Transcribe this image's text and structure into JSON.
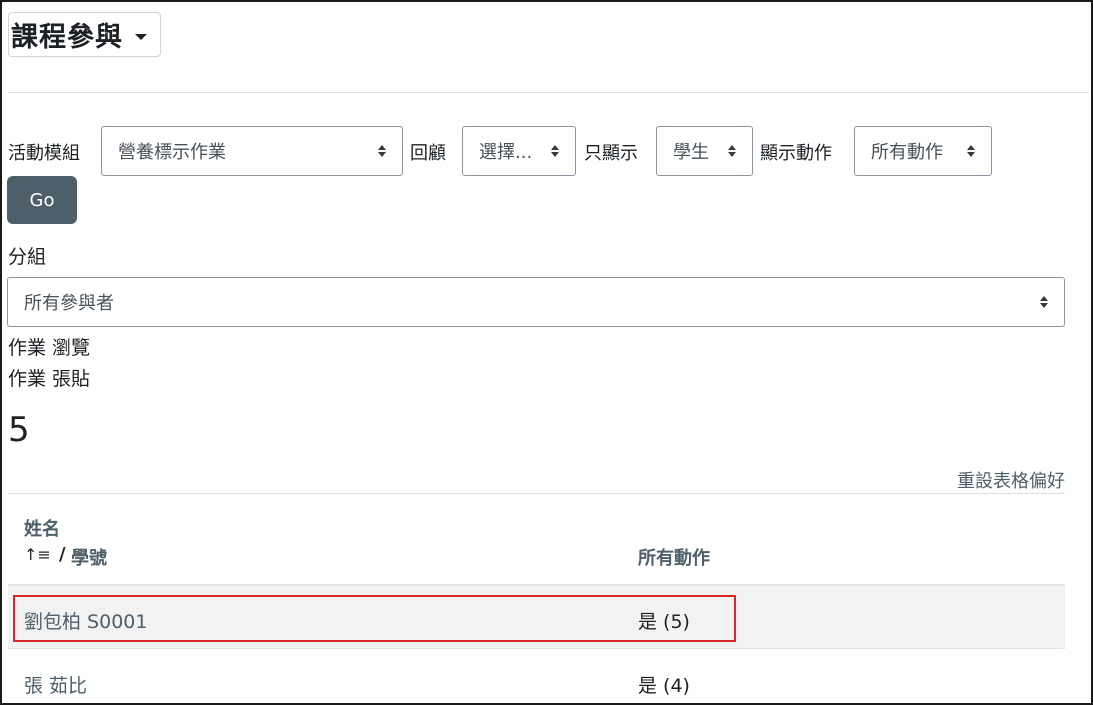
{
  "page_title": "課程參與",
  "filters": {
    "activity_label": "活動模組",
    "activity_value": "營養標示作業",
    "lookback_label": "回顧",
    "lookback_value": "選擇...",
    "show_only_label": "只顯示",
    "show_only_value": "學生",
    "show_actions_label": "顯示動作",
    "show_actions_value": "所有動作",
    "go_label": "Go",
    "group_label": "分組",
    "group_value": "所有參與者"
  },
  "info": {
    "line1": "作業 瀏覽",
    "line2": "作業 張貼",
    "count": "5"
  },
  "table": {
    "reset_label": "重設表格偏好",
    "col_name": "姓名",
    "sort_icon": "↑≡",
    "separator": "/",
    "col_id": "學號",
    "col_actions": "所有動作",
    "rows": [
      {
        "name": "劉包柏 S0001",
        "actions": "是 (5)"
      },
      {
        "name": "張 茹比",
        "actions": "是 (4)"
      }
    ]
  },
  "colors": {
    "highlight": "#d9262b",
    "button_bg": "#4d5f69",
    "link": "#4d5f69"
  }
}
